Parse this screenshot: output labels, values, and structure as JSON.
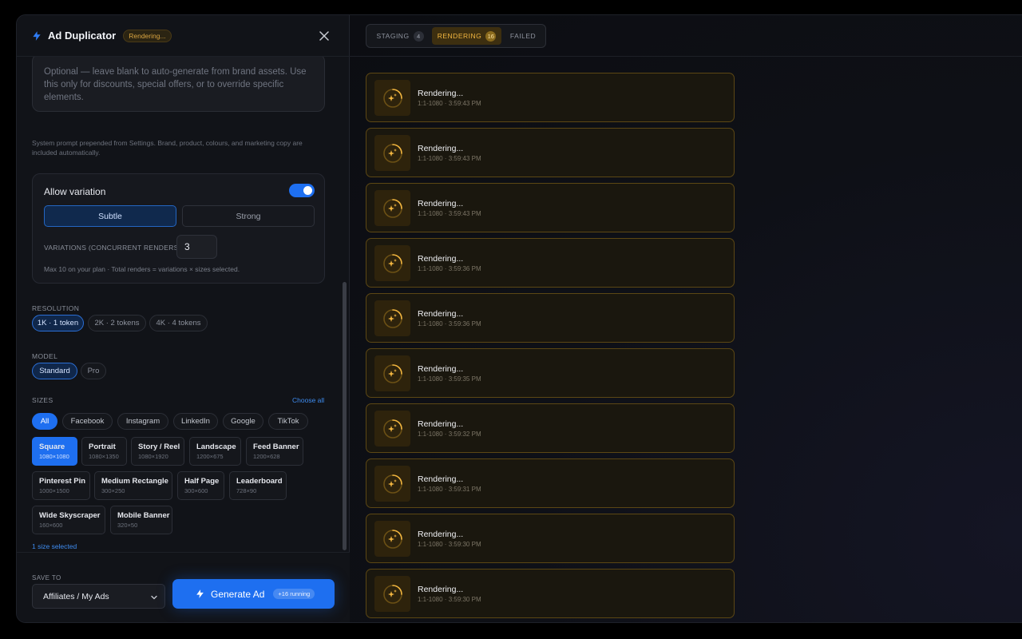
{
  "header": {
    "title": "Ad Duplicator",
    "status": "Rendering..."
  },
  "prompt": {
    "placeholder": "Optional — leave blank to auto-generate from brand assets. Use this only for discounts, special offers, or to override specific elements.",
    "system_note": "System prompt prepended from Settings. Brand, product, colours, and marketing copy are included automatically."
  },
  "variation": {
    "label": "Allow variation",
    "enabled": true,
    "subtle_label": "Subtle",
    "strong_label": "Strong",
    "selected": "Subtle",
    "count_label": "VARIATIONS (CONCURRENT RENDERS)",
    "count_value": "3",
    "help": "Max 10 on your plan · Total renders = variations × sizes selected."
  },
  "resolution": {
    "label": "RESOLUTION",
    "options": [
      "1K · 1 token",
      "2K · 2 tokens",
      "4K · 4 tokens"
    ],
    "selected": "1K · 1 token"
  },
  "model": {
    "label": "MODEL",
    "options": [
      "Standard",
      "Pro"
    ],
    "selected": "Standard"
  },
  "sizes": {
    "label": "SIZES",
    "choose_all": "Choose all",
    "filters": [
      "All",
      "Facebook",
      "Instagram",
      "LinkedIn",
      "Google",
      "TikTok"
    ],
    "active_filter": "All",
    "tiles": [
      {
        "name": "Square",
        "dim": "1080×1080",
        "selected": true
      },
      {
        "name": "Portrait",
        "dim": "1080×1350",
        "selected": false
      },
      {
        "name": "Story / Reel",
        "dim": "1080×1920",
        "selected": false
      },
      {
        "name": "Landscape",
        "dim": "1200×675",
        "selected": false
      },
      {
        "name": "Feed Banner",
        "dim": "1200×628",
        "selected": false
      },
      {
        "name": "Pinterest Pin",
        "dim": "1000×1500",
        "selected": false
      },
      {
        "name": "Medium Rectangle",
        "dim": "300×250",
        "selected": false
      },
      {
        "name": "Half Page",
        "dim": "300×600",
        "selected": false
      },
      {
        "name": "Leaderboard",
        "dim": "728×90",
        "selected": false
      },
      {
        "name": "Wide Skyscraper",
        "dim": "160×600",
        "selected": false
      },
      {
        "name": "Mobile Banner",
        "dim": "320×50",
        "selected": false
      }
    ],
    "selected_count": "1 size selected"
  },
  "footer": {
    "save_label": "SAVE TO",
    "save_value": "Affiliates / My Ads",
    "generate_label": "Generate Ad",
    "running": "+16 running"
  },
  "tabs": [
    {
      "label": "STAGING",
      "count": "4"
    },
    {
      "label": "RENDERING",
      "count": "16"
    },
    {
      "label": "FAILED",
      "count": ""
    }
  ],
  "jobs": [
    {
      "title": "Rendering...",
      "meta": "1:1-1080 · 3:59:43 PM"
    },
    {
      "title": "Rendering...",
      "meta": "1:1-1080 · 3:59:43 PM"
    },
    {
      "title": "Rendering...",
      "meta": "1:1-1080 · 3:59:43 PM"
    },
    {
      "title": "Rendering...",
      "meta": "1:1-1080 · 3:59:36 PM"
    },
    {
      "title": "Rendering...",
      "meta": "1:1-1080 · 3:59:36 PM"
    },
    {
      "title": "Rendering...",
      "meta": "1:1-1080 · 3:59:35 PM"
    },
    {
      "title": "Rendering...",
      "meta": "1:1-1080 · 3:59:32 PM"
    },
    {
      "title": "Rendering...",
      "meta": "1:1-1080 · 3:59:31 PM"
    },
    {
      "title": "Rendering...",
      "meta": "1:1-1080 · 3:59:30 PM"
    },
    {
      "title": "Rendering...",
      "meta": "1:1-1080 · 3:59:30 PM"
    }
  ],
  "colors": {
    "accent": "#1e6ff0",
    "rendering": "#f2b640",
    "link": "#3e8cf0"
  },
  "icons": {
    "app": "bolt-icon",
    "close": "close-icon",
    "job": "sparkle-spinner-icon",
    "select": "chevron-down-icon"
  }
}
